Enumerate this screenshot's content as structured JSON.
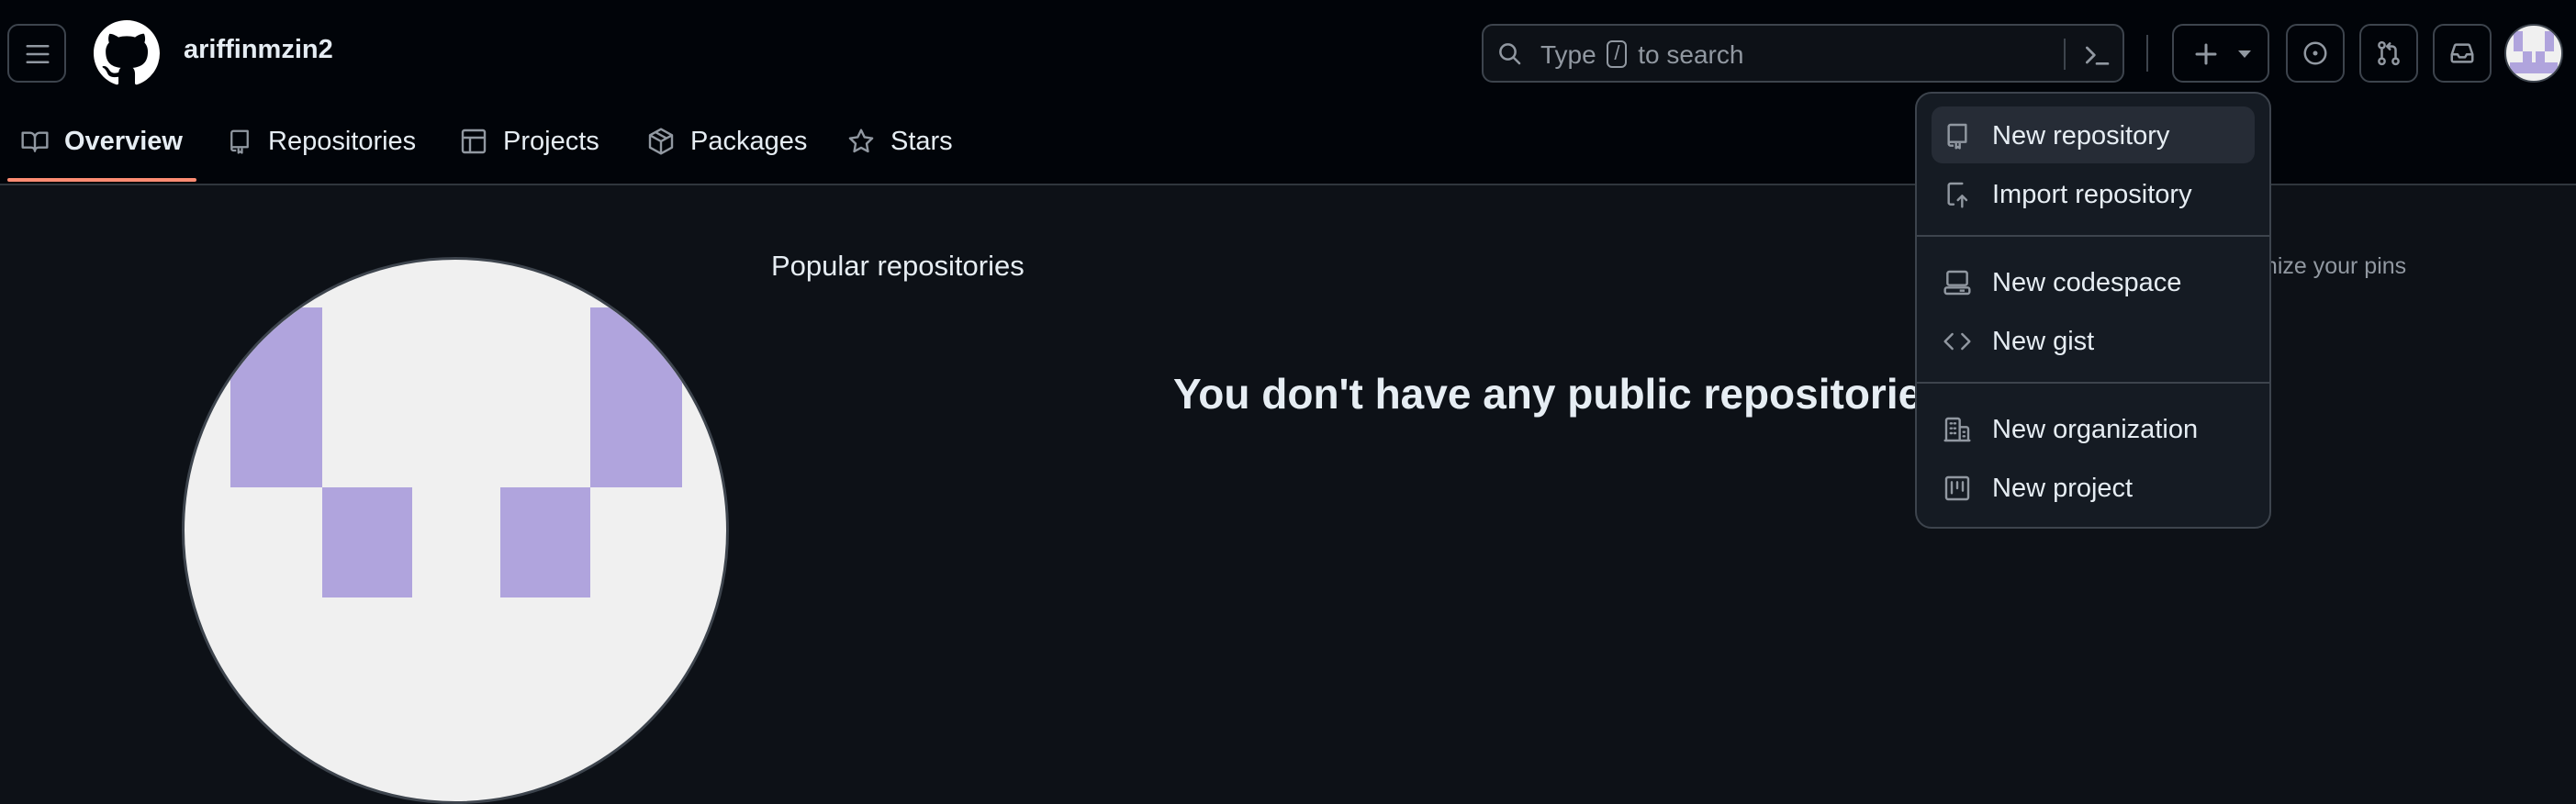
{
  "header": {
    "username": "ariffinmzin2",
    "search_prefix": "Type",
    "search_key": "/",
    "search_suffix": "to search"
  },
  "tabs": [
    {
      "label": "Overview",
      "icon": "book-icon",
      "active": true
    },
    {
      "label": "Repositories",
      "icon": "repo-icon"
    },
    {
      "label": "Projects",
      "icon": "table-icon"
    },
    {
      "label": "Packages",
      "icon": "package-icon"
    },
    {
      "label": "Stars",
      "icon": "star-icon"
    }
  ],
  "main": {
    "popular_title": "Popular repositories",
    "customize_fragment": "mize your pins",
    "empty_message": "You don't have any public repositories"
  },
  "create_menu": {
    "items": [
      {
        "label": "New repository",
        "icon": "repo-icon"
      },
      {
        "label": "Import repository",
        "icon": "repo-push-icon"
      },
      {
        "label": "New codespace",
        "icon": "codespace-icon"
      },
      {
        "label": "New gist",
        "icon": "code-icon"
      },
      {
        "label": "New organization",
        "icon": "organization-icon"
      },
      {
        "label": "New project",
        "icon": "project-icon"
      }
    ]
  },
  "colors": {
    "header_bg": "#010409",
    "page_bg": "#0d1117",
    "active_tab_underline": "#fd8c73",
    "avatar_purple": "#b0a4dd"
  }
}
